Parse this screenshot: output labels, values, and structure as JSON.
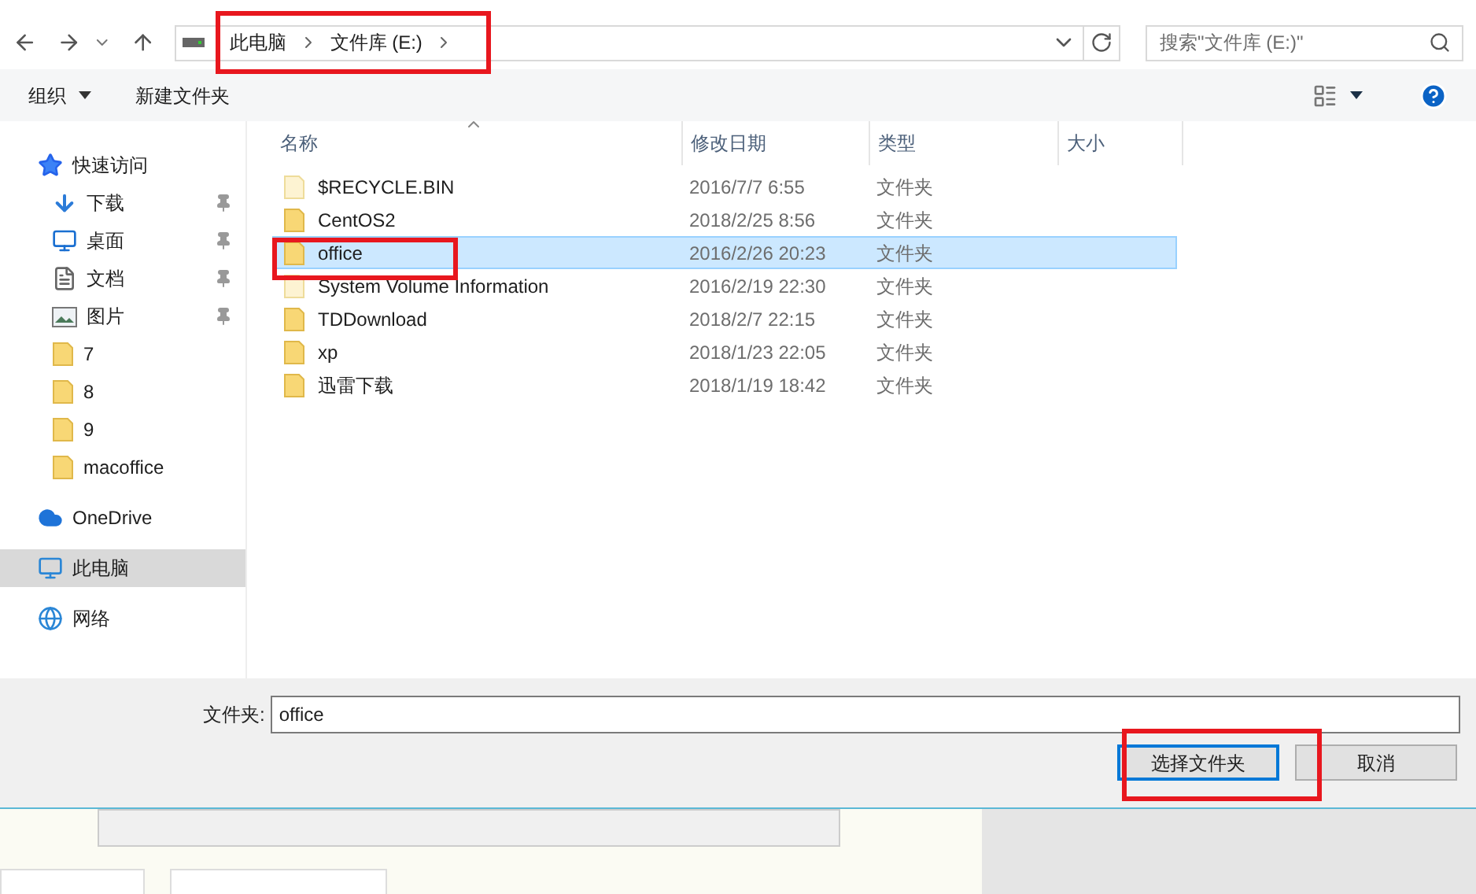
{
  "address_bar": {
    "crumbs": [
      "此电脑",
      "文件库 (E:)"
    ]
  },
  "search": {
    "placeholder": "搜索\"文件库 (E:)\""
  },
  "toolbar": {
    "buttons": [
      "组织",
      "新建文件夹"
    ]
  },
  "sidebar": {
    "items": [
      {
        "label": "快速访问",
        "kind": "star",
        "selected": false,
        "children": [
          {
            "label": "下载",
            "kind": "download",
            "pinned": true,
            "selected": false
          },
          {
            "label": "桌面",
            "kind": "desktop",
            "pinned": true,
            "selected": false
          },
          {
            "label": "文档",
            "kind": "document",
            "pinned": true,
            "selected": false
          },
          {
            "label": "图片",
            "kind": "picture",
            "pinned": true,
            "selected": false
          },
          {
            "label": "7",
            "kind": "folder",
            "pinned": false,
            "selected": false
          },
          {
            "label": "8",
            "kind": "folder",
            "pinned": false,
            "selected": false
          },
          {
            "label": "9",
            "kind": "folder",
            "pinned": false,
            "selected": false
          },
          {
            "label": "macoffice",
            "kind": "folder",
            "pinned": false,
            "selected": false
          }
        ]
      },
      {
        "label": "OneDrive",
        "kind": "cloud",
        "selected": false
      },
      {
        "label": "此电脑",
        "kind": "computer",
        "selected": true
      },
      {
        "label": "网络",
        "kind": "network",
        "selected": false
      }
    ]
  },
  "table": {
    "columns": [
      "名称",
      "修改日期",
      "类型",
      "大小"
    ],
    "rows": [
      {
        "name": "$RECYCLE.BIN",
        "date": "2016/7/7 6:55",
        "type": "文件夹",
        "hidden": true,
        "selected": false
      },
      {
        "name": "CentOS2",
        "date": "2018/2/25 8:56",
        "type": "文件夹",
        "hidden": false,
        "selected": false
      },
      {
        "name": "office",
        "date": "2016/2/26 20:23",
        "type": "文件夹",
        "hidden": false,
        "selected": true
      },
      {
        "name": "System Volume Information",
        "date": "2016/2/19 22:30",
        "type": "文件夹",
        "hidden": true,
        "selected": false
      },
      {
        "name": "TDDownload",
        "date": "2018/2/7 22:15",
        "type": "文件夹",
        "hidden": false,
        "selected": false
      },
      {
        "name": "xp",
        "date": "2018/1/23 22:05",
        "type": "文件夹",
        "hidden": false,
        "selected": false
      },
      {
        "name": "迅雷下载",
        "date": "2018/1/19 18:42",
        "type": "文件夹",
        "hidden": false,
        "selected": false
      }
    ]
  },
  "footer": {
    "field_label": "文件夹:",
    "field_value": "office",
    "buttons": [
      "选择文件夹",
      "取消"
    ]
  }
}
